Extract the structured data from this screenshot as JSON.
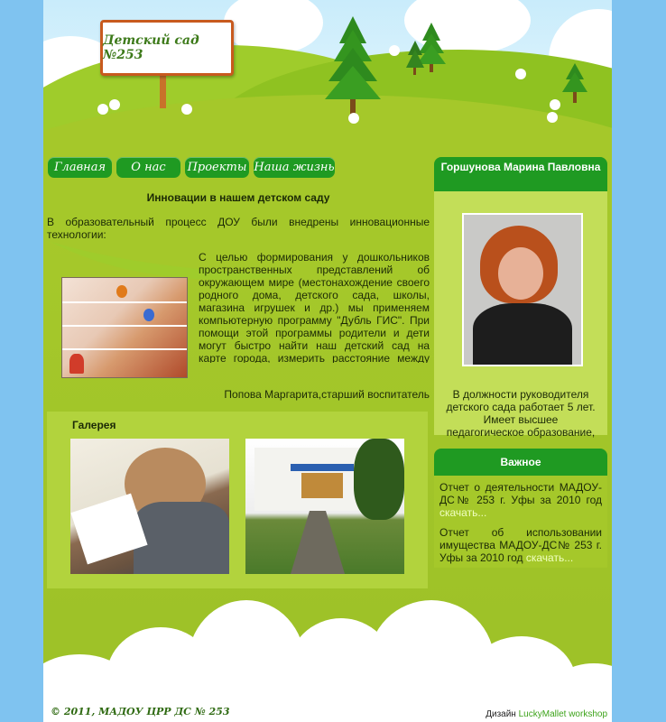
{
  "header": {
    "site_title": "Детский сад №253"
  },
  "nav": {
    "items": [
      {
        "label": "Главная"
      },
      {
        "label": "О нас"
      },
      {
        "label": "Проекты"
      },
      {
        "label": "Наша жизнь"
      }
    ]
  },
  "main": {
    "heading": "Инновации в нашем детском саду",
    "intro": "В образовательный процесс ДОУ были внедрены инновационные технологии:",
    "body": "С целью формирования у дошкольников пространственных представлений об окружающем мире (местонахождение своего родного дома, детского сада, школы, магазина игрушек и др.) мы применяем компьютерную программу \"Дубль ГИС\". При помощи этой программы родители и дети могут быстро найти наш детский сад на карте города, измерить расстояние между выбранными точками, рассчитать время,",
    "author": "Попова Маргарита,старший воспитатель"
  },
  "gallery": {
    "title": "Галерея"
  },
  "sidebar": {
    "director": {
      "name": "Горшунова Марина Павловна",
      "bio": "В должности руководителя детского сада работает 5 лет. Имеет высшее педагогическое образование, высшую"
    },
    "important": {
      "title": "Важное",
      "items": [
        {
          "text": "Отчет о деятельности МАДОУ-ДС№ 253 г. Уфы за 2010 год",
          "link": "скачать..."
        },
        {
          "text": "Отчет об использовании имущества МАДОУ-ДС№ 253 г. Уфы за 2010 год",
          "link": "скачать..."
        }
      ]
    }
  },
  "footer": {
    "copyright": "© 2011, МАДОУ ЦРР ДС № 253",
    "design_label": "Дизайн",
    "design_link": "LuckyMallet workshop"
  },
  "colors": {
    "page_bg": "#7fc3f0",
    "grass": "#a5c82a",
    "button_green": "#1f9a22",
    "sign_border": "#c85a1e"
  }
}
